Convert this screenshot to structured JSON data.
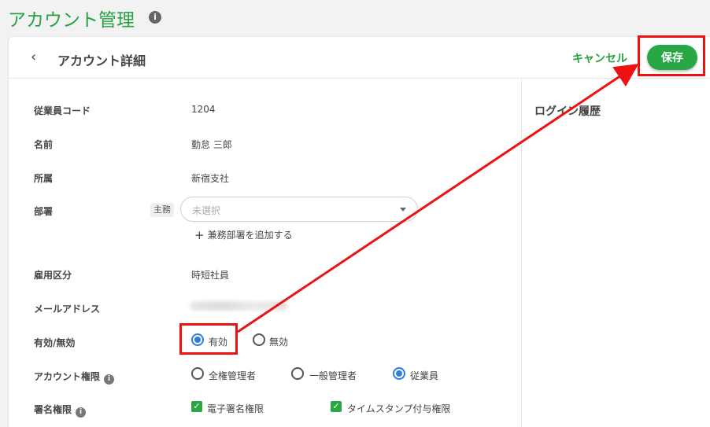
{
  "page": {
    "title": "アカウント管理",
    "info_glyph": "i"
  },
  "header": {
    "back_glyph": "‹",
    "title": "アカウント詳細",
    "cancel_label": "キャンセル",
    "save_label": "保存"
  },
  "side_panel": {
    "title": "ログイン履歴"
  },
  "fields": {
    "employee_code": {
      "label": "従業員コード",
      "value": "1204"
    },
    "name": {
      "label": "名前",
      "value": "勤怠 三郎"
    },
    "affiliation": {
      "label": "所属",
      "value": "新宿支社"
    },
    "department": {
      "label": "部署",
      "tag": "主務",
      "placeholder": "未選択",
      "add_label": "兼務部署を追加する",
      "add_glyph": "+"
    },
    "employment_type": {
      "label": "雇用区分",
      "value": "時短社員"
    },
    "email": {
      "label": "メールアドレス"
    },
    "status": {
      "label": "有効/無効",
      "options": [
        "有効",
        "無効"
      ],
      "selected": "有効"
    },
    "account_role": {
      "label": "アカウント権限",
      "options": [
        "全権管理者",
        "一般管理者",
        "従業員"
      ],
      "selected": "従業員"
    },
    "signature_role": {
      "label": "署名権限",
      "options": [
        "電子署名権限",
        "タイムスタンプ付与権限"
      ],
      "checked": [
        "電子署名権限",
        "タイムスタンプ付与権限"
      ]
    }
  },
  "colors": {
    "brand_green": "#28a745",
    "radio_blue": "#2f7de1",
    "annotation_red": "#ee1111"
  }
}
